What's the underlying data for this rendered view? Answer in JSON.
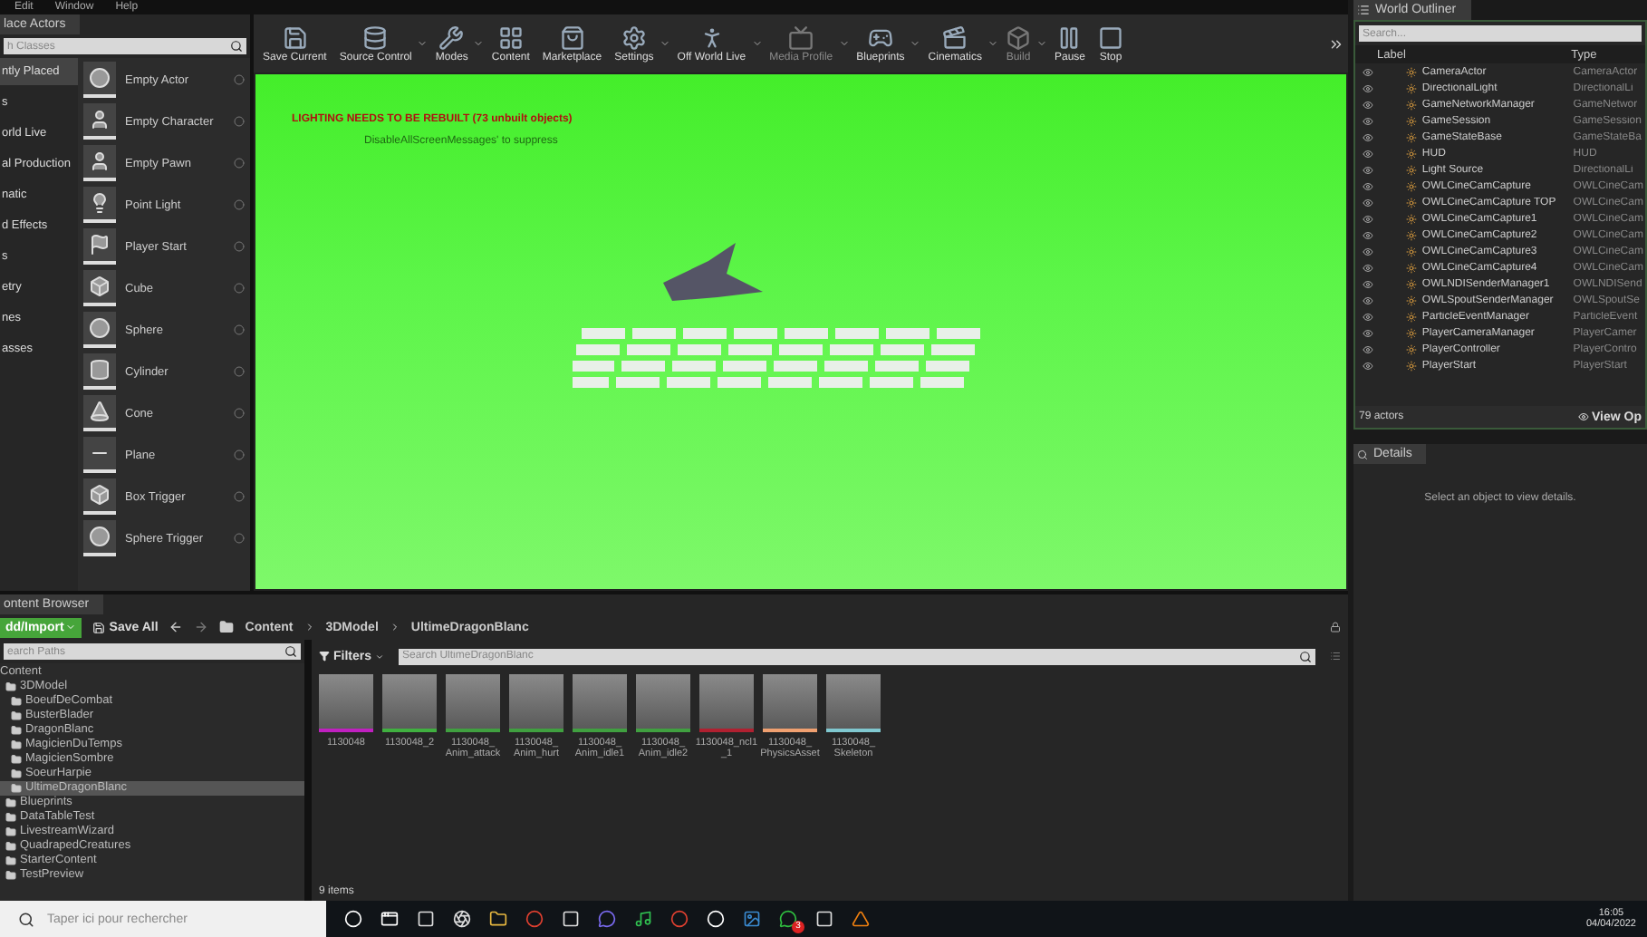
{
  "menu": [
    "Edit",
    "Window",
    "Help"
  ],
  "place_actors": {
    "tab": "lace Actors",
    "search": {
      "placeholder": "h Classes"
    },
    "categories": [
      {
        "label": "ntly Placed",
        "selected": true
      },
      {
        "label": "s",
        "selected": false
      },
      {
        "label": "orld Live",
        "selected": false
      },
      {
        "label": "al Production",
        "selected": false
      },
      {
        "label": "natic",
        "selected": false
      },
      {
        "label": "d Effects",
        "selected": false
      },
      {
        "label": "s",
        "selected": false
      },
      {
        "label": "etry",
        "selected": false
      },
      {
        "label": "nes",
        "selected": false
      },
      {
        "label": "asses",
        "selected": false
      }
    ],
    "items": [
      {
        "label": "Empty Actor",
        "kind": "sphere"
      },
      {
        "label": "Empty Character",
        "kind": "person"
      },
      {
        "label": "Empty Pawn",
        "kind": "pawn"
      },
      {
        "label": "Point Light",
        "kind": "light"
      },
      {
        "label": "Player Start",
        "kind": "flag"
      },
      {
        "label": "Cube",
        "kind": "cube"
      },
      {
        "label": "Sphere",
        "kind": "sphere"
      },
      {
        "label": "Cylinder",
        "kind": "cylinder"
      },
      {
        "label": "Cone",
        "kind": "cone"
      },
      {
        "label": "Plane",
        "kind": "plane"
      },
      {
        "label": "Box Trigger",
        "kind": "cube"
      },
      {
        "label": "Sphere Trigger",
        "kind": "sphere"
      }
    ]
  },
  "toolbar": [
    {
      "label": "Save Current",
      "kind": "save",
      "caret": false,
      "disabled": false
    },
    {
      "label": "Source Control",
      "kind": "source",
      "caret": true,
      "disabled": false
    },
    {
      "label": "Modes",
      "kind": "modes",
      "caret": true,
      "disabled": false
    },
    {
      "label": "Content",
      "kind": "content",
      "caret": false,
      "disabled": false
    },
    {
      "label": "Marketplace",
      "kind": "market",
      "caret": false,
      "disabled": false
    },
    {
      "label": "Settings",
      "kind": "settings",
      "caret": true,
      "disabled": false
    },
    {
      "label": "Off World Live",
      "kind": "person",
      "caret": true,
      "disabled": false
    },
    {
      "label": "Media Profile",
      "kind": "tv",
      "caret": true,
      "disabled": true
    },
    {
      "label": "Blueprints",
      "kind": "blueprints",
      "caret": true,
      "disabled": false
    },
    {
      "label": "Cinematics",
      "kind": "cinematics",
      "caret": true,
      "disabled": false
    },
    {
      "label": "Build",
      "kind": "build",
      "caret": true,
      "disabled": true
    },
    {
      "label": "Pause",
      "kind": "pause",
      "caret": false,
      "disabled": false
    },
    {
      "label": "Stop",
      "kind": "stop",
      "caret": false,
      "disabled": false
    }
  ],
  "viewport": {
    "warning": "LIGHTING NEEDS TO BE REBUILT (73 unbuilt objects)",
    "hint": "DisableAllScreenMessages' to suppress"
  },
  "world_outliner": {
    "tab": "World Outliner",
    "search": {
      "placeholder": "Search..."
    },
    "columns": [
      "Label",
      "Type"
    ],
    "rows": [
      {
        "label": "CameraActor",
        "type": "CameraActor"
      },
      {
        "label": "DirectionalLight",
        "type": "DirectionalLi"
      },
      {
        "label": "GameNetworkManager",
        "type": "GameNetwor"
      },
      {
        "label": "GameSession",
        "type": "GameSession"
      },
      {
        "label": "GameStateBase",
        "type": "GameStateBa"
      },
      {
        "label": "HUD",
        "type": "HUD"
      },
      {
        "label": "Light Source",
        "type": "DirectionalLi"
      },
      {
        "label": "OWLCineCamCapture",
        "type": "OWLCineCam"
      },
      {
        "label": "OWLCineCamCapture TOP",
        "type": "OWLCineCam"
      },
      {
        "label": "OWLCineCamCapture1",
        "type": "OWLCineCam"
      },
      {
        "label": "OWLCineCamCapture2",
        "type": "OWLCineCam"
      },
      {
        "label": "OWLCineCamCapture3",
        "type": "OWLCineCam"
      },
      {
        "label": "OWLCineCamCapture4",
        "type": "OWLCineCam"
      },
      {
        "label": "OWLNDISenderManager1",
        "type": "OWLNDISend"
      },
      {
        "label": "OWLSpoutSenderManager",
        "type": "OWLSpoutSe"
      },
      {
        "label": "ParticleEventManager",
        "type": "ParticleEvent"
      },
      {
        "label": "PlayerCameraManager",
        "type": "PlayerCamer"
      },
      {
        "label": "PlayerController",
        "type": "PlayerContro"
      },
      {
        "label": "PlayerStart",
        "type": "PlayerStart"
      }
    ],
    "count": "79 actors",
    "view_options": "View Op"
  },
  "details": {
    "tab": "Details",
    "message": "Select an object to view details."
  },
  "content_browser": {
    "tab": "ontent Browser",
    "add_import": "dd/Import",
    "save_all": "Save All",
    "breadcrumb": [
      "Content",
      "3DModel",
      "UltimeDragonBlanc"
    ],
    "path_search": {
      "placeholder": "earch Paths"
    },
    "tree": [
      {
        "label": "Content",
        "selected": false,
        "children": [
          {
            "label": "3DModel",
            "selected": false,
            "children": [
              {
                "label": "BoeufDeCombat",
                "selected": false
              },
              {
                "label": "BusterBlader",
                "selected": false
              },
              {
                "label": "DragonBlanc",
                "selected": false
              },
              {
                "label": "MagicienDuTemps",
                "selected": false
              },
              {
                "label": "MagicienSombre",
                "selected": false
              },
              {
                "label": "SoeurHarpie",
                "selected": false
              },
              {
                "label": "UltimeDragonBlanc",
                "selected": true
              }
            ]
          },
          {
            "label": "Blueprints",
            "selected": false
          },
          {
            "label": "DataTableTest",
            "selected": false
          },
          {
            "label": "LivestreamWizard",
            "selected": false
          },
          {
            "label": "QuadrapedCreatures",
            "selected": false
          },
          {
            "label": "StarterContent",
            "selected": false
          },
          {
            "label": "TestPreview",
            "selected": false
          }
        ]
      }
    ],
    "filters": "Filters",
    "asset_search": {
      "placeholder": "Search UltimeDragonBlanc"
    },
    "assets": [
      {
        "name": "1130048",
        "color": "#c020c0"
      },
      {
        "name": "1130048_2",
        "color": "#40b040"
      },
      {
        "name": "1130048_ Anim_attack",
        "color": "#40a040"
      },
      {
        "name": "1130048_ Anim_hurt",
        "color": "#40a040"
      },
      {
        "name": "1130048_ Anim_idle1",
        "color": "#40a040"
      },
      {
        "name": "1130048_ Anim_idle2",
        "color": "#40a040"
      },
      {
        "name": "1130048_ncl1 _1",
        "color": "#b02030"
      },
      {
        "name": "1130048_ PhysicsAsset",
        "color": "#f0a070"
      },
      {
        "name": "1130048_ Skeleton",
        "color": "#80c8d0"
      }
    ],
    "item_count": "9 items"
  },
  "taskbar": {
    "search": {
      "placeholder": "Taper ici pour rechercher"
    },
    "apps": [
      {
        "kind": "start"
      },
      {
        "kind": "taskview"
      },
      {
        "kind": "app"
      },
      {
        "kind": "obs"
      },
      {
        "kind": "folder"
      },
      {
        "kind": "chrome"
      },
      {
        "kind": "app"
      },
      {
        "kind": "discord"
      },
      {
        "kind": "spotify"
      },
      {
        "kind": "chrome"
      },
      {
        "kind": "unreal"
      },
      {
        "kind": "photo"
      },
      {
        "kind": "whatsapp",
        "badge": "3"
      },
      {
        "kind": "app"
      },
      {
        "kind": "vlc"
      }
    ],
    "time": "16:05",
    "date": "04/04/2022"
  }
}
